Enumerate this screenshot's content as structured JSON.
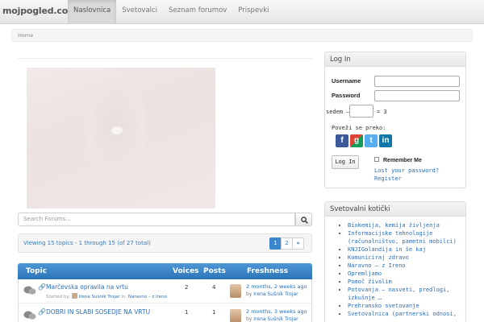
{
  "brand": "mojpogled.com",
  "nav": [
    "Naslovnica",
    "Svetovalci",
    "Seznam forumov",
    "Prispevki"
  ],
  "breadcrumb": "Home",
  "search": {
    "placeholder": "Search Forums..."
  },
  "viewing": "Viewing 15 topics - 1 through 15 (of 27 total)",
  "pagination": {
    "pages": [
      "1",
      "2"
    ],
    "next": "»"
  },
  "table": {
    "headers": {
      "topic": "Topic",
      "voices": "Voices",
      "posts": "Posts",
      "freshness": "Freshness"
    },
    "rows": [
      {
        "title": "Marčevska opravila na vrtu",
        "started_by_label": "Started by:",
        "author": "Irena Sušnik Trojar",
        "in_label": "in:",
        "forum": "Naravno – z Ireno",
        "voices": "2",
        "posts": "4",
        "freshness": "2 months, 2 weeks ago",
        "by_label": "by",
        "last_by": "Irena Sušnik Trojar"
      },
      {
        "title": "DOBRI IN SLABI SOSEDJE NA VRTU",
        "started_by_label": "",
        "author": "",
        "in_label": "",
        "forum": "",
        "voices": "1",
        "posts": "1",
        "freshness": "2 months, 3 weeks ago",
        "by_label": "by",
        "last_by": "Irena Sušnik Trojar"
      }
    ]
  },
  "login": {
    "title": "Log In",
    "username_label": "Username",
    "password_label": "Password",
    "captcha_prefix": "sedem –",
    "captcha_suffix": "= 3",
    "connect_label": "Poveži se preko:",
    "social_icons": [
      "facebook-icon",
      "google-icon",
      "twitter-icon",
      "linkedin-icon"
    ],
    "button": "Log In",
    "remember": "Remember Me",
    "lost_password_1": "Lost your password?",
    "lost_password_2": "Register"
  },
  "corners": {
    "title": "Svetovalni kotički",
    "items": [
      "Biokemija, kemija življenja",
      "Informacijske tehnologije",
      "(računalništvo, pametni mobilci)",
      "KNJIGolandija in še kaj",
      "Komuniciraj zdravo",
      "Naravno – z Ireno",
      "Opremljamo",
      "Pomoč živalim",
      "Potovanja – nasveti, predlogi,",
      "izkušnje …",
      "Prehransko svetovanje",
      "Svetovalnica (partnerski odnosi,"
    ]
  },
  "colors": {
    "accent": "#2a6ebb",
    "table_header": "#3b86cc"
  }
}
